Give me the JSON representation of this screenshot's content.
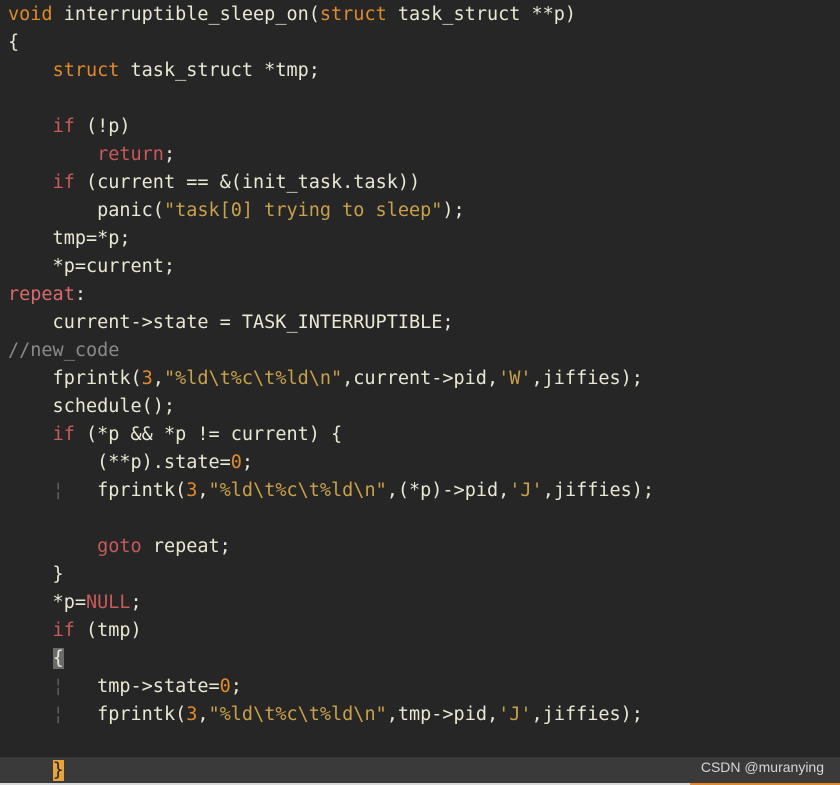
{
  "editor": {
    "lines": [
      [
        {
          "t": "void ",
          "c": "type"
        },
        {
          "t": "interruptible_sleep_on(",
          "c": "txt"
        },
        {
          "t": "struct ",
          "c": "type"
        },
        {
          "t": "task_struct **p)",
          "c": "txt"
        }
      ],
      [
        {
          "t": "{",
          "c": "txt"
        }
      ],
      [
        {
          "t": "    ",
          "c": "txt"
        },
        {
          "t": "struct ",
          "c": "type"
        },
        {
          "t": "task_struct *tmp;",
          "c": "txt"
        }
      ],
      [],
      [
        {
          "t": "    ",
          "c": "txt"
        },
        {
          "t": "if ",
          "c": "kw"
        },
        {
          "t": "(!p)",
          "c": "txt"
        }
      ],
      [
        {
          "t": "        ",
          "c": "txt"
        },
        {
          "t": "return",
          "c": "kw"
        },
        {
          "t": ";",
          "c": "txt"
        }
      ],
      [
        {
          "t": "    ",
          "c": "txt"
        },
        {
          "t": "if ",
          "c": "kw"
        },
        {
          "t": "(current == &(init_task.task))",
          "c": "txt"
        }
      ],
      [
        {
          "t": "        panic(",
          "c": "txt"
        },
        {
          "t": "\"task[0] trying to sleep\"",
          "c": "str"
        },
        {
          "t": ");",
          "c": "txt"
        }
      ],
      [
        {
          "t": "    tmp=*p;",
          "c": "txt"
        }
      ],
      [
        {
          "t": "    *p=current;",
          "c": "txt"
        }
      ],
      [
        {
          "t": "repeat",
          "c": "label"
        },
        {
          "t": ":",
          "c": "txt"
        }
      ],
      [
        {
          "t": "    current->state = TASK_INTERRUPTIBLE;",
          "c": "txt"
        }
      ],
      [
        {
          "t": "//new_code",
          "c": "com"
        }
      ],
      [
        {
          "t": "    fprintk(",
          "c": "txt"
        },
        {
          "t": "3",
          "c": "num"
        },
        {
          "t": ",",
          "c": "txt"
        },
        {
          "t": "\"%ld\\t%c\\t%ld\\n\"",
          "c": "str"
        },
        {
          "t": ",current->pid,",
          "c": "txt"
        },
        {
          "t": "'W'",
          "c": "str"
        },
        {
          "t": ",jiffies);",
          "c": "txt"
        }
      ],
      [
        {
          "t": "    schedule();",
          "c": "txt"
        }
      ],
      [
        {
          "t": "    ",
          "c": "txt"
        },
        {
          "t": "if ",
          "c": "kw"
        },
        {
          "t": "(*p && *p != current) {",
          "c": "txt"
        }
      ],
      [
        {
          "t": "        (**p).state=",
          "c": "txt"
        },
        {
          "t": "0",
          "c": "num"
        },
        {
          "t": ";",
          "c": "txt"
        }
      ],
      [
        {
          "t": "    ",
          "c": "txt"
        },
        {
          "t": "¦",
          "c": "guide"
        },
        {
          "t": "   fprintk(",
          "c": "txt"
        },
        {
          "t": "3",
          "c": "num"
        },
        {
          "t": ",",
          "c": "txt"
        },
        {
          "t": "\"%ld\\t%c\\t%ld\\n\"",
          "c": "str"
        },
        {
          "t": ",(*p)->pid,",
          "c": "txt"
        },
        {
          "t": "'J'",
          "c": "str"
        },
        {
          "t": ",jiffies);",
          "c": "txt"
        }
      ],
      [],
      [
        {
          "t": "        ",
          "c": "txt"
        },
        {
          "t": "goto ",
          "c": "kw"
        },
        {
          "t": "repeat;",
          "c": "txt"
        }
      ],
      [
        {
          "t": "    }",
          "c": "txt"
        }
      ],
      [
        {
          "t": "    *p=",
          "c": "txt"
        },
        {
          "t": "NULL",
          "c": "kw"
        },
        {
          "t": ";",
          "c": "txt"
        }
      ],
      [
        {
          "t": "    ",
          "c": "txt"
        },
        {
          "t": "if ",
          "c": "kw"
        },
        {
          "t": "(tmp)",
          "c": "txt"
        }
      ],
      [
        {
          "t": "    ",
          "c": "txt"
        },
        {
          "t": "{",
          "c": "brace-hl"
        }
      ],
      [
        {
          "t": "    ",
          "c": "txt"
        },
        {
          "t": "¦",
          "c": "guide"
        },
        {
          "t": "   tmp->state=",
          "c": "txt"
        },
        {
          "t": "0",
          "c": "num"
        },
        {
          "t": ";",
          "c": "txt"
        }
      ],
      [
        {
          "t": "    ",
          "c": "txt"
        },
        {
          "t": "¦",
          "c": "guide"
        },
        {
          "t": "   fprintk(",
          "c": "txt"
        },
        {
          "t": "3",
          "c": "num"
        },
        {
          "t": ",",
          "c": "txt"
        },
        {
          "t": "\"%ld\\t%c\\t%ld\\n\"",
          "c": "str"
        },
        {
          "t": ",tmp->pid,",
          "c": "txt"
        },
        {
          "t": "'J'",
          "c": "str"
        },
        {
          "t": ",jiffies);",
          "c": "txt"
        }
      ],
      [],
      [
        {
          "t": "    ",
          "c": "txt"
        },
        {
          "t": "}",
          "c": "brace-cursor"
        }
      ]
    ],
    "cursor_line_index": 27
  },
  "watermark": "CSDN @muranying"
}
